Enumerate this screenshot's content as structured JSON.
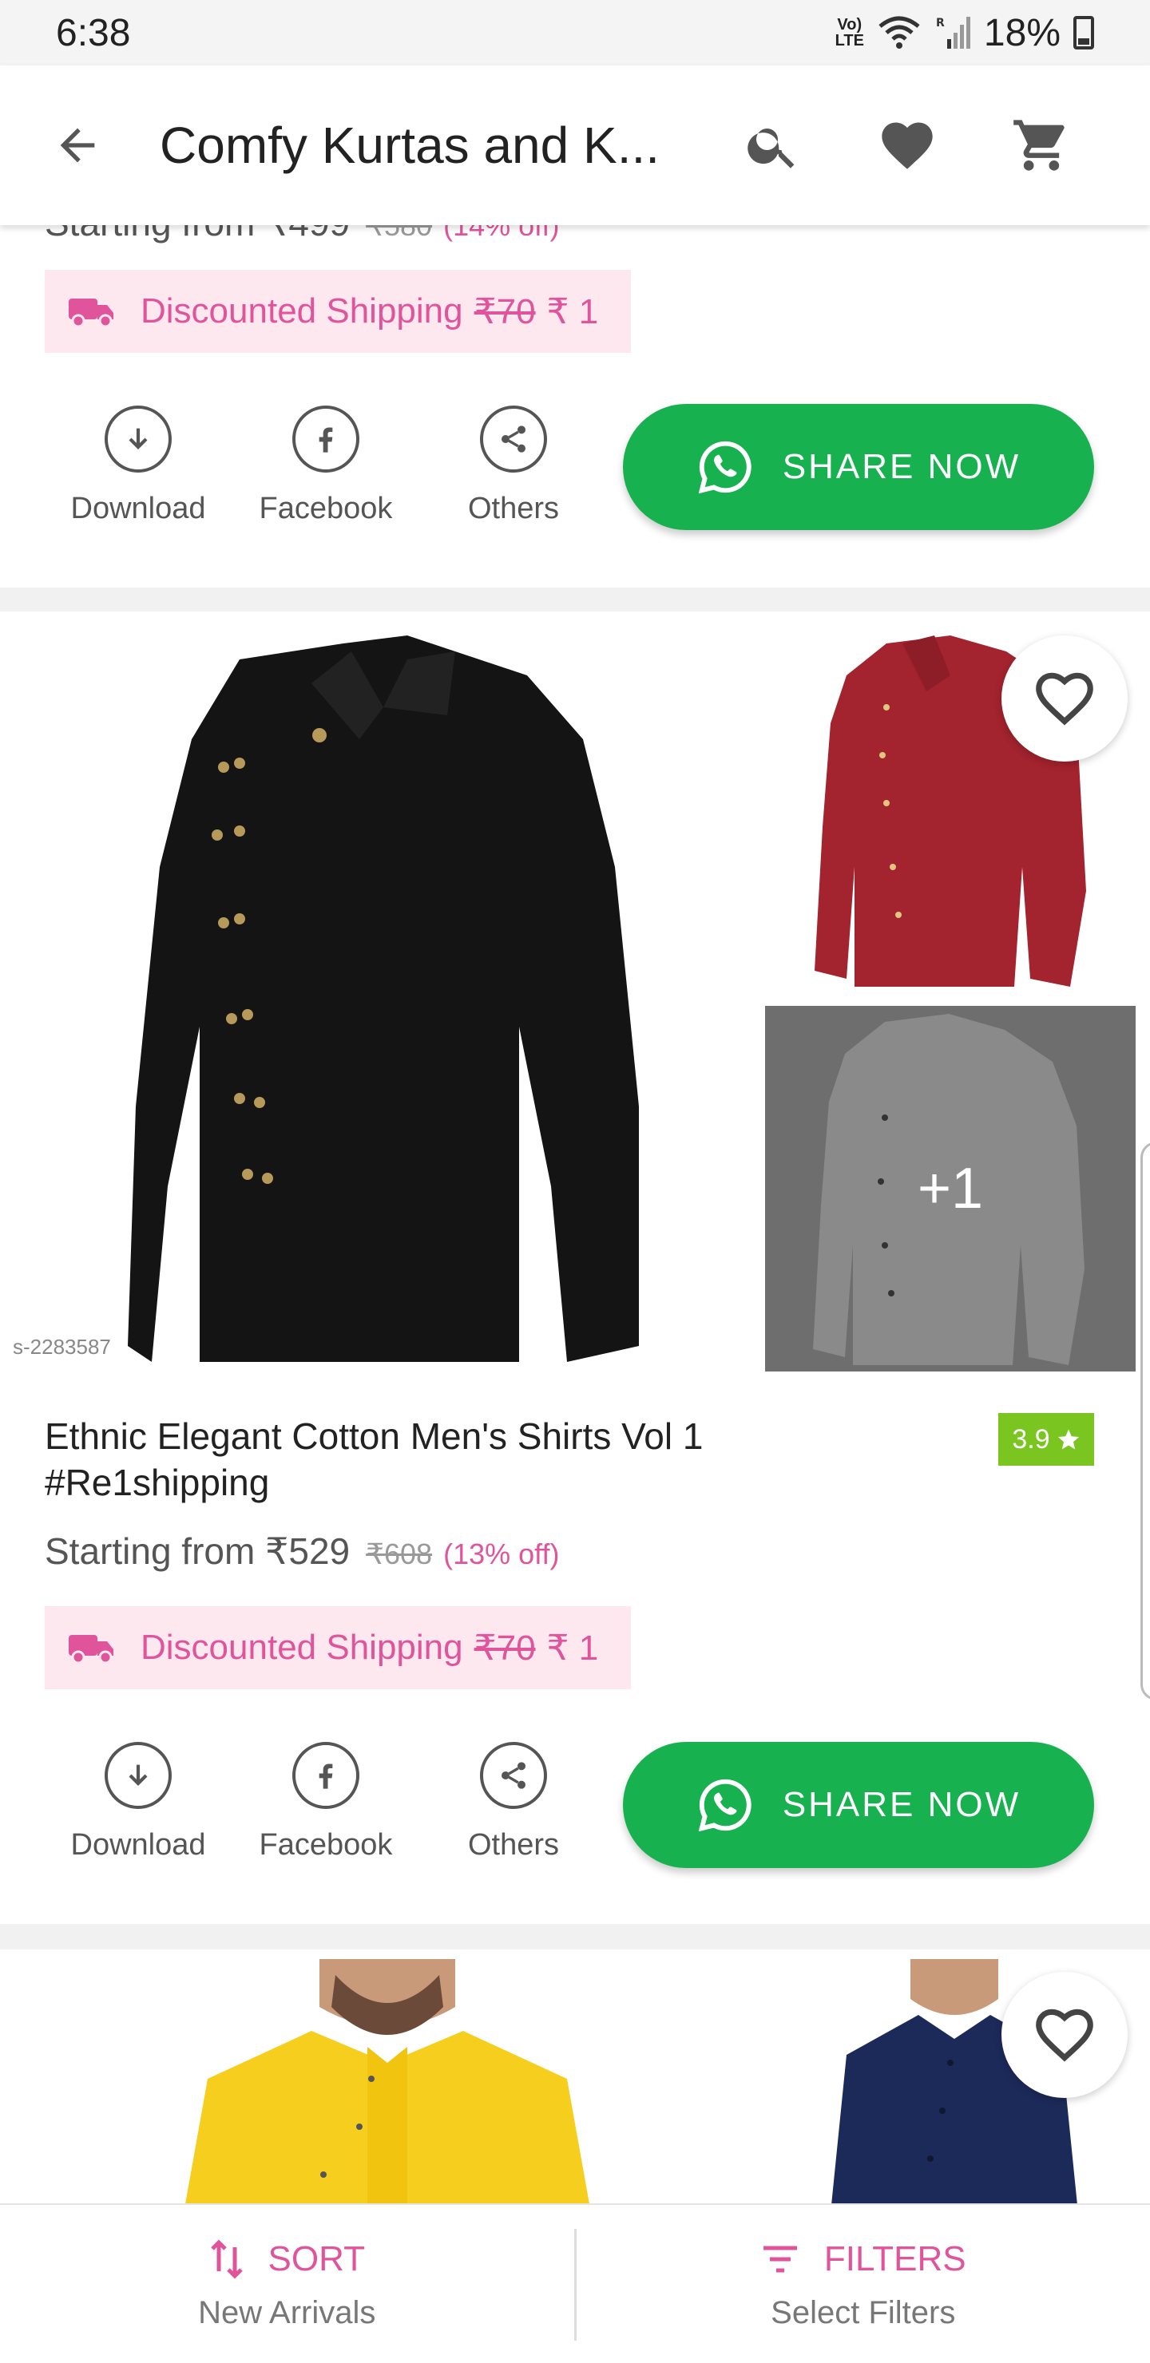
{
  "status_bar": {
    "time": "6:38",
    "network_top": "Vo)",
    "network_bottom": "LTE",
    "roaming": "R",
    "battery": "18%"
  },
  "app_bar": {
    "title": "Comfy Kurtas and K..."
  },
  "card_top": {
    "price_partial": "Starting from ₹499",
    "mrp_partial": "₹580",
    "discount_partial": "(14% off)",
    "shipping_label": "Discounted Shipping",
    "shipping_old": "₹70",
    "shipping_new": "₹ 1",
    "actions": {
      "download": "Download",
      "facebook": "Facebook",
      "others": "Others"
    },
    "share_label": "SHARE NOW"
  },
  "card_main": {
    "sku": "s-2283587",
    "more_images": "+1",
    "title": "Ethnic Elegant Cotton Men's Shirts Vol 1 #Re1shipping",
    "rating": "3.9",
    "price": "Starting from ₹529",
    "mrp": "₹608",
    "discount": "(13% off)",
    "shipping_label": "Discounted Shipping",
    "shipping_old": "₹70",
    "shipping_new": "₹ 1",
    "actions": {
      "download": "Download",
      "facebook": "Facebook",
      "others": "Others"
    },
    "share_label": "SHARE NOW"
  },
  "bottom_bar": {
    "sort_label": "SORT",
    "sort_value": "New Arrivals",
    "filters_label": "FILTERS",
    "filters_value": "Select Filters"
  },
  "colors": {
    "accent_pink": "#e0549b",
    "whatsapp_green": "#18b14f",
    "rating_green": "#7ac520"
  }
}
